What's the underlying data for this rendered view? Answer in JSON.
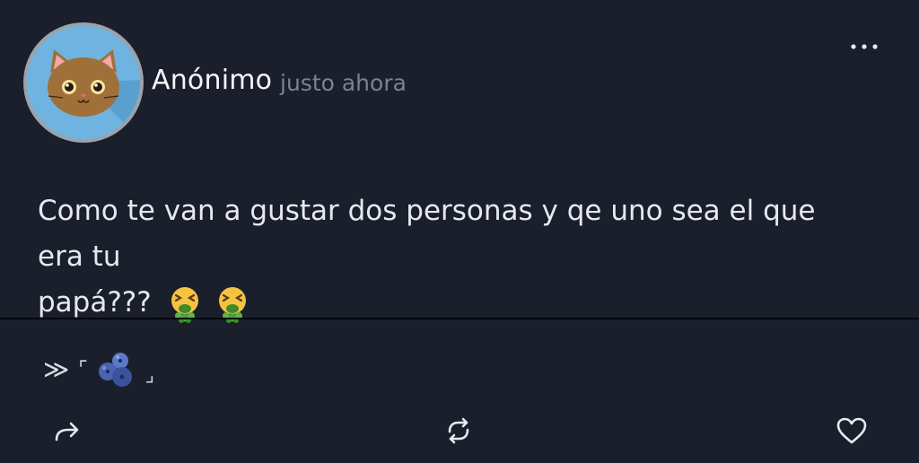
{
  "post": {
    "author": "Anónimo",
    "timestamp": "justo ahora",
    "text_line1": "Como te van a gustar dos personas y qe uno sea el que era tu",
    "text_line2": "papá???"
  },
  "tag": {
    "chevrons": "≫",
    "bracket_open": "⌜",
    "bracket_close": "⌟",
    "icon": "blueberries-icon"
  },
  "actions": [
    {
      "name": "share",
      "icon": "share-arrow-icon"
    },
    {
      "name": "repost",
      "icon": "repost-icon"
    },
    {
      "name": "like",
      "icon": "heart-icon"
    }
  ],
  "colors": {
    "background": "#1a1f2b",
    "text": "#e6e9ef",
    "muted": "#7b8290",
    "avatar_bg": "#6fb4e0",
    "avatar_ring": "#9aa3ad"
  }
}
